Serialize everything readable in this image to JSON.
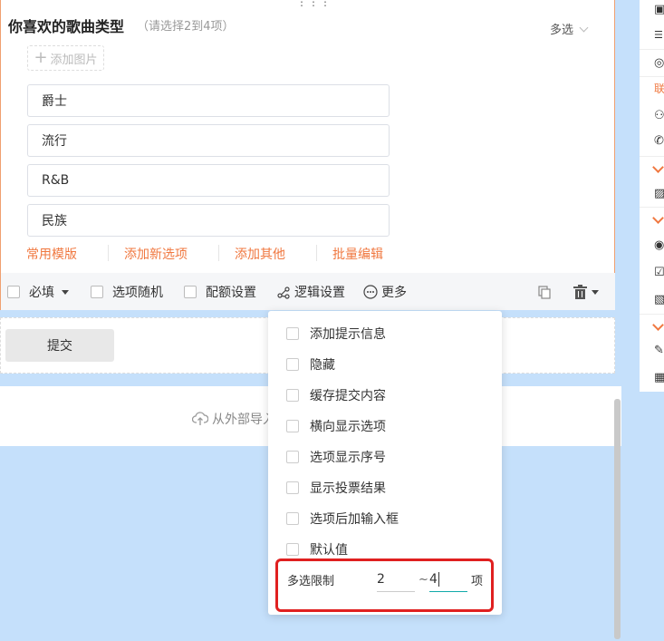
{
  "question": {
    "title": "你喜欢的歌曲类型",
    "hint": "（请选择2到4项）",
    "type_label": "多选",
    "add_image": "添加图片",
    "options": [
      "爵士",
      "流行",
      "R&B",
      "民族"
    ],
    "actions": [
      "常用模版",
      "添加新选项",
      "添加其他",
      "批量编辑"
    ]
  },
  "toolbar": {
    "required": "必填",
    "random": "选项随机",
    "quota": "配额设置",
    "logic": "逻辑设置",
    "more": "更多"
  },
  "submit_label": "提交",
  "import_label": "从外部导入",
  "more_menu": {
    "items": [
      "添加提示信息",
      "隐藏",
      "缓存提交内容",
      "横向显示选项",
      "选项显示序号",
      "显示投票结果",
      "选项后加输入框",
      "默认值"
    ],
    "limit_label": "多选限制",
    "limit_min": "2",
    "limit_sep": "~",
    "limit_max": "4",
    "limit_unit": "项"
  },
  "right_panel": {
    "section_label": "联"
  },
  "colors": {
    "accent": "#f07840",
    "highlight_border": "#e02020",
    "background": "#c5e0fb"
  }
}
